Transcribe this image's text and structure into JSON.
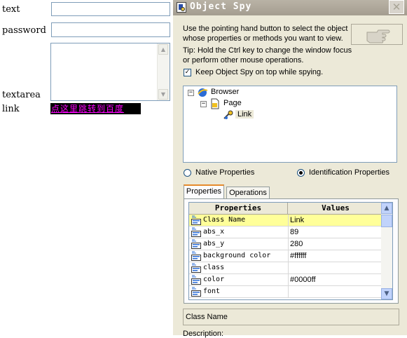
{
  "web_form": {
    "text_label": "text",
    "password_label": "password",
    "textarea_label": "textarea",
    "link_label": "link",
    "link_text": "点这里跳转到百度"
  },
  "spy": {
    "title": "Object Spy",
    "instructions": "Use the pointing hand button to select the object whose properties or methods you want to view.",
    "tip": "Tip: Hold the Ctrl key to change the window focus or perform other mouse operations.",
    "keep_on_top_label": "Keep Object Spy on top while spying.",
    "keep_on_top_checked": true,
    "tree": [
      {
        "label": "Browser",
        "icon": "browser-icon",
        "level": 0,
        "expanded": true
      },
      {
        "label": "Page",
        "icon": "page-icon",
        "level": 1,
        "expanded": true
      },
      {
        "label": "Link",
        "icon": "link-icon",
        "level": 2,
        "selected": true
      }
    ],
    "radio_native": "Native Properties",
    "radio_identification": "Identification Properties",
    "selected_radio": "identification",
    "tabs": [
      "Properties",
      "Operations"
    ],
    "active_tab": "Properties",
    "grid_headers": {
      "properties": "Properties",
      "values": "Values"
    },
    "rows": [
      {
        "name": "Class Name",
        "value": "Link",
        "selected": true
      },
      {
        "name": "abs_x",
        "value": "89"
      },
      {
        "name": "abs_y",
        "value": "280"
      },
      {
        "name": "background color",
        "value": "#ffffff"
      },
      {
        "name": "class",
        "value": ""
      },
      {
        "name": "color",
        "value": "#0000ff"
      },
      {
        "name": "font",
        "value": ""
      }
    ],
    "selected_property": "Class Name",
    "description_label": "Description:",
    "colors": {
      "selected_row": "#ffff99",
      "titlebar": "#a49d90",
      "window_bg": "#ece9d8"
    }
  }
}
